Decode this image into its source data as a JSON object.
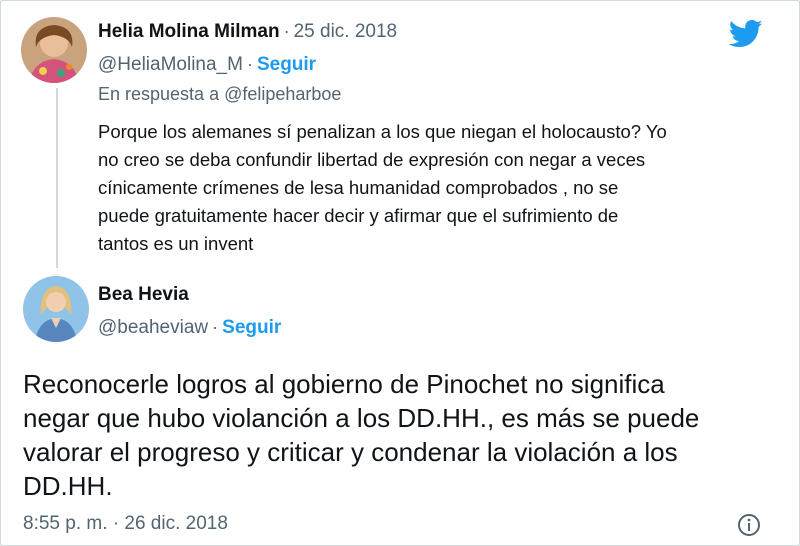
{
  "reply_tweet": {
    "author_name": "Helia Molina Milman",
    "date": "25 dic. 2018",
    "handle": "@HeliaMolina_M",
    "follow_label": "Seguir",
    "reply_context": "En respuesta a @felipeharboe",
    "text": "Porque los alemanes sí penalizan a los que niegan el holocausto? Yo\nno creo se deba confundir libertad de expresión con negar a veces\ncínicamente crímenes de lesa humanidad  comprobados , no se\npuede gratuitamente hacer decir y afirmar que el sufrimiento de\ntantos es  un invent"
  },
  "main_tweet": {
    "author_name": "Bea Hevia",
    "handle": "@beaheviaw",
    "follow_label": "Seguir",
    "text": "Reconocerle logros al gobierno de Pinochet no significa\nnegar que hubo violanción a los DD.HH., es más se puede\nvalorar el progreso y criticar y condenar la violación a los\nDD.HH.",
    "timestamp": "8:55 p. m. · 26 dic. 2018"
  },
  "separator": "·",
  "icons": {
    "brand": "twitter-bird-icon",
    "info": "info-icon"
  },
  "colors": {
    "accent": "#1d9bf0",
    "muted": "#536471",
    "text": "#0f1419",
    "border": "#cfd9de"
  }
}
